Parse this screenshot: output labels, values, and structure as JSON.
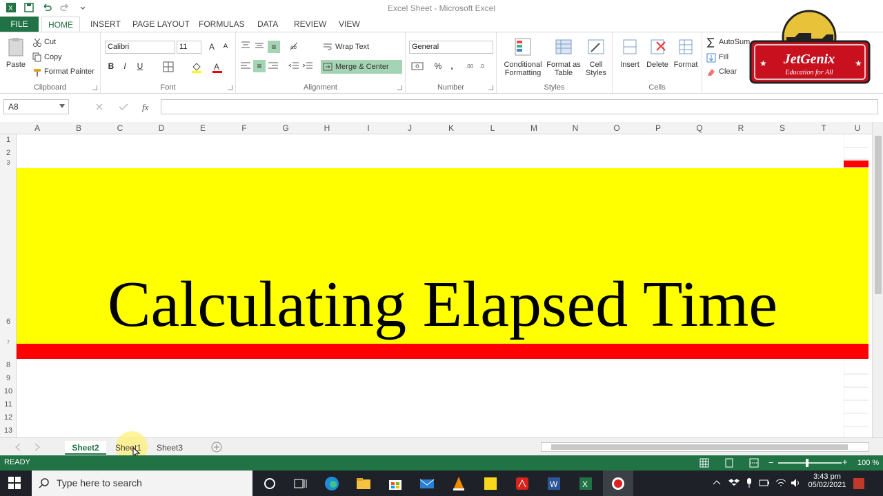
{
  "window": {
    "title": "Excel Sheet - Microsoft Excel"
  },
  "ribbon_tabs": [
    "FILE",
    "HOME",
    "INSERT",
    "PAGE LAYOUT",
    "FORMULAS",
    "DATA",
    "REVIEW",
    "VIEW"
  ],
  "clipboard": {
    "paste": "Paste",
    "cut": "Cut",
    "copy": "Copy",
    "format_painter": "Format Painter",
    "label": "Clipboard"
  },
  "font": {
    "name": "Calibri",
    "size": "11",
    "bold": "B",
    "italic": "I",
    "underline": "U",
    "label": "Font"
  },
  "alignment": {
    "wrap_text": "Wrap Text",
    "merge_center": "Merge & Center",
    "label": "Alignment"
  },
  "number": {
    "format": "General",
    "percent": "%",
    "comma": ",",
    "label": "Number"
  },
  "styles": {
    "conditional": "Conditional",
    "conditional2": "Formatting",
    "format_as": "Format as",
    "format_as2": "Table",
    "cell": "Cell",
    "cell2": "Styles",
    "label": "Styles"
  },
  "cells": {
    "insert": "Insert",
    "delete": "Delete",
    "format": "Format",
    "label": "Cells"
  },
  "editing": {
    "autosum": "AutoSum",
    "fill": "Fill",
    "clear": "Clear"
  },
  "formula_bar": {
    "name_box": "A8",
    "fx": "fx",
    "content": ""
  },
  "columns": [
    "A",
    "B",
    "C",
    "D",
    "E",
    "F",
    "G",
    "H",
    "I",
    "J",
    "K",
    "L",
    "M",
    "N",
    "O",
    "P",
    "Q",
    "R",
    "S",
    "T",
    "U"
  ],
  "rows": [
    "1",
    "2",
    "3",
    "6",
    "7",
    "8",
    "9",
    "10",
    "11",
    "12",
    "13"
  ],
  "sheet": {
    "headline": "Calculating Elapsed Time",
    "band_color": "#ffff00",
    "stripe_color": "#ff0000"
  },
  "sheet_tabs": [
    "Sheet2",
    "Sheet1",
    "Sheet3"
  ],
  "active_sheet": "Sheet2",
  "status": {
    "ready": "READY",
    "zoom": "100 %"
  },
  "taskbar": {
    "search_placeholder": "Type here to search",
    "time": "3:43 pm",
    "date": "05/02/2021"
  },
  "logo": {
    "brand": "JetGenix",
    "tagline": "Education for All"
  }
}
